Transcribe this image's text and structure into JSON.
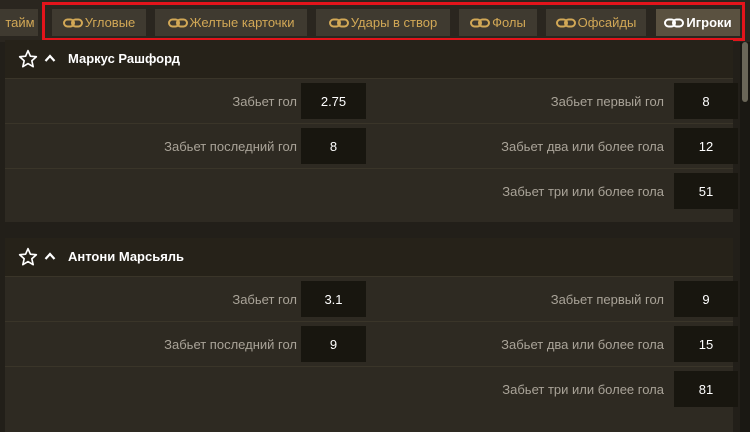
{
  "tabs": [
    {
      "label": "тайм",
      "icon": "",
      "active": false
    },
    {
      "label": "Угловые",
      "icon": "link-icon",
      "active": false
    },
    {
      "label": "Желтые карточки",
      "icon": "link-icon",
      "active": false
    },
    {
      "label": "Удары в створ",
      "icon": "link-icon",
      "active": false
    },
    {
      "label": "Фолы",
      "icon": "link-icon",
      "active": false
    },
    {
      "label": "Офсайды",
      "icon": "link-icon",
      "active": false
    },
    {
      "label": "Игроки",
      "icon": "link-icon",
      "active": true
    }
  ],
  "colors": {
    "accent_gold": "#d2a856",
    "highlight_red": "#e3141b",
    "background": "#221f19",
    "odd_box": "#18160f"
  },
  "players": [
    {
      "name": "Маркус Рашфорд",
      "icons": [
        "star-outline-icon",
        "chevron-up-icon"
      ],
      "markets": [
        {
          "label": "Забьет гол",
          "odd": "2.75"
        },
        {
          "label": "Забьет первый гол",
          "odd": "8"
        },
        {
          "label": "Забьет последний гол",
          "odd": "8"
        },
        {
          "label": "Забьет два или более гола",
          "odd": "12"
        },
        {
          "label": "Забьет три или более гола",
          "odd": "51"
        }
      ]
    },
    {
      "name": "Антони Марсьяль",
      "icons": [
        "star-outline-icon",
        "chevron-up-icon"
      ],
      "markets": [
        {
          "label": "Забьет гол",
          "odd": "3.1"
        },
        {
          "label": "Забьет первый гол",
          "odd": "9"
        },
        {
          "label": "Забьет последний гол",
          "odd": "9"
        },
        {
          "label": "Забьет два или более гола",
          "odd": "15"
        },
        {
          "label": "Забьет три или более гола",
          "odd": "81"
        }
      ]
    }
  ]
}
